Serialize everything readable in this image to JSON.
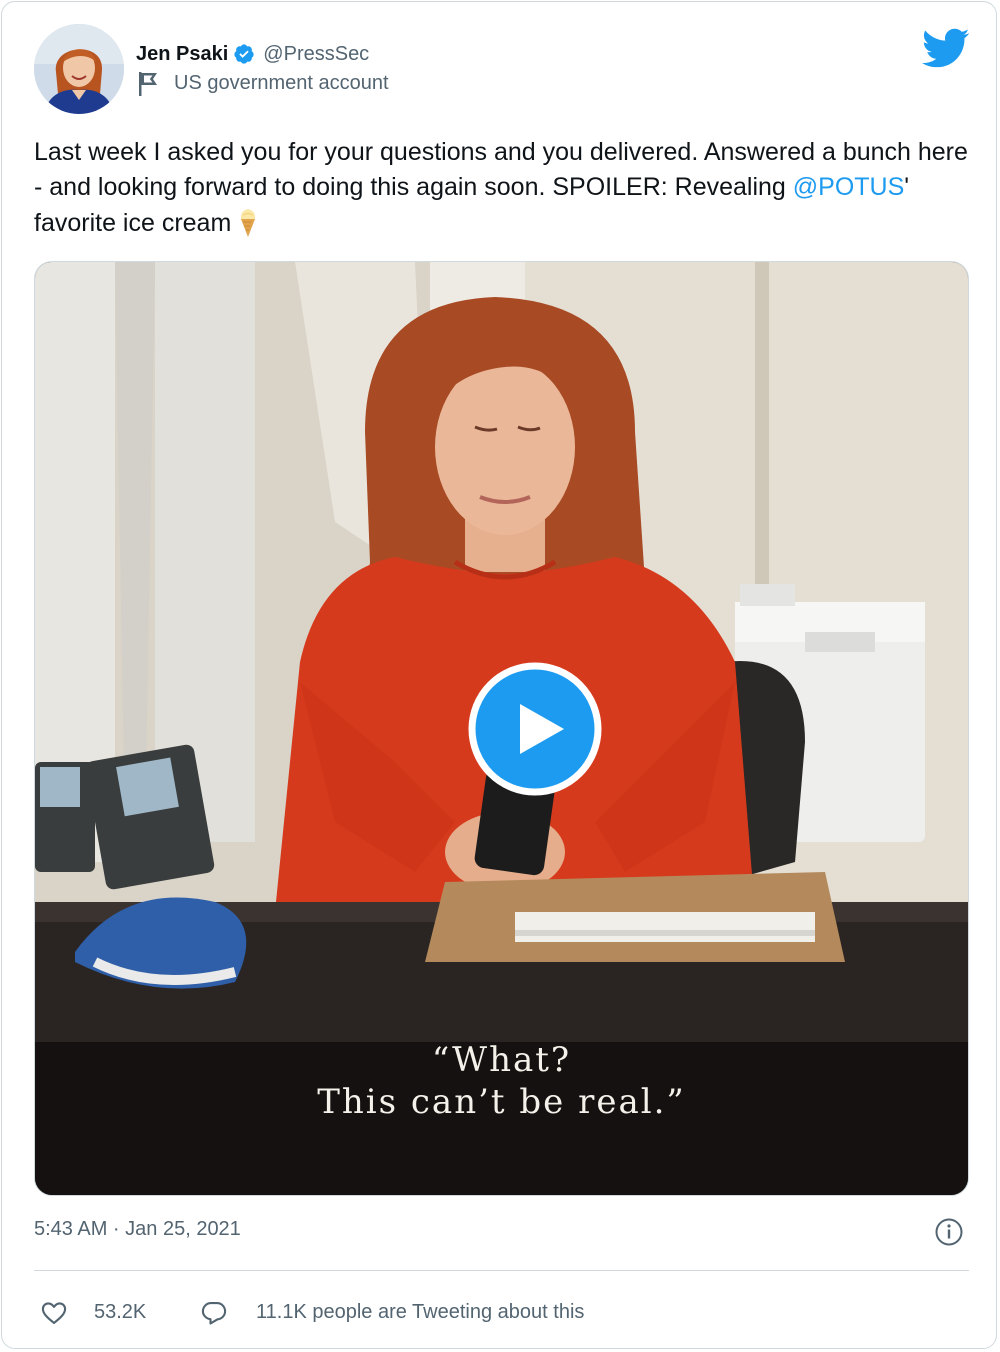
{
  "author": {
    "display_name": "Jen Psaki",
    "handle": "@PressSec",
    "account_label": "US government account",
    "avatar_icon": "avatar-photo",
    "verified_icon": "verified-badge-icon"
  },
  "tweet": {
    "text_before": "Last week I asked you for your questions and you delivered. Answered a bunch here - and looking forward to doing this again soon. SPOILER: Revealing ",
    "mention": "@POTUS",
    "text_after": "' favorite ice cream",
    "emoji": "ice-cream-cone-emoji"
  },
  "media": {
    "type": "video",
    "caption_line1": "“What?",
    "caption_line2": "This can’t be real.”",
    "play_icon": "play-icon"
  },
  "footer": {
    "timestamp": "5:43 AM · Jan 25, 2021",
    "likes": "53.2K",
    "replies_text": "11.1K people are Tweeting about this"
  },
  "colors": {
    "accent": "#1d9bf0",
    "secondary_text": "#536471",
    "border": "#cfd9de"
  }
}
